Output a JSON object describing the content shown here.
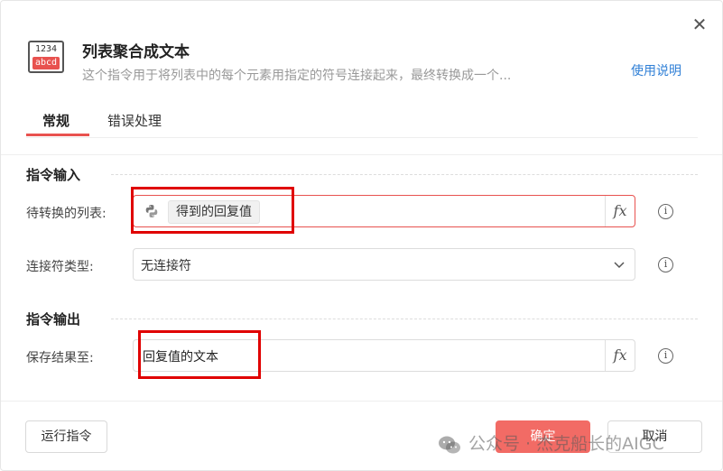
{
  "dialog": {
    "title": "列表聚合成文本",
    "description": "这个指令用于将列表中的每个元素用指定的符号连接起来，最终转换成一个...",
    "help_link": "使用说明",
    "icon_top_text": "1234",
    "icon_bottom_text": "abcd"
  },
  "tabs": [
    {
      "label": "常规",
      "active": true
    },
    {
      "label": "错误处理",
      "active": false
    }
  ],
  "input_section": {
    "title": "指令输入",
    "list_field": {
      "label": "待转换的列表:",
      "chip": "得到的回复值",
      "fx": "fx"
    },
    "joiner_field": {
      "label": "连接符类型:",
      "value": "无连接符"
    }
  },
  "output_section": {
    "title": "指令输出",
    "save_field": {
      "label": "保存结果至:",
      "value": "回复值的文本",
      "fx": "fx"
    }
  },
  "footer": {
    "run_label": "运行指令",
    "ok_label": "确定",
    "cancel_label": "取消"
  },
  "watermark": {
    "text": "公众号 · 杰克船长的AIGC"
  },
  "colors": {
    "accent": "#e8524f",
    "link": "#2f7fd6",
    "annotation": "#e00000"
  }
}
